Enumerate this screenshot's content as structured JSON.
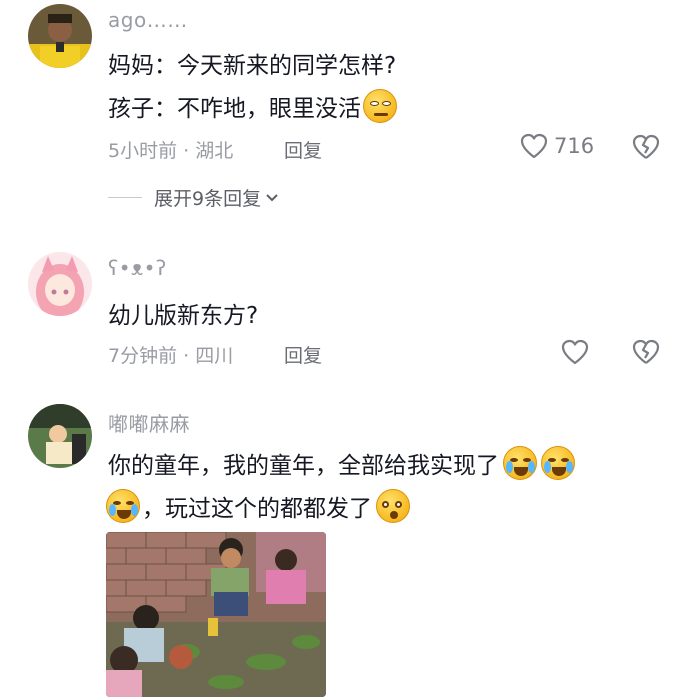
{
  "comments": [
    {
      "username": "ago……",
      "lines": [
        "妈妈：今天新来的同学怎样?",
        "孩子：不咋地，眼里没活"
      ],
      "time_location": "5小时前 · 湖北",
      "reply_label": "回复",
      "like_count": "716",
      "expand_label": "展开9条回复"
    },
    {
      "username": "ʕ•ᴥ•ʔ",
      "lines": [
        "幼儿版新东方?"
      ],
      "time_location": "7分钟前 · 四川",
      "reply_label": "回复"
    },
    {
      "username": "嘟嘟麻麻",
      "lines": [
        "你的童年，我的童年，全部给我实现了",
        "，玩过这个的都都发了"
      ],
      "time_location": "",
      "reply_label": ""
    }
  ],
  "icons": {
    "like": "heart-outline-icon",
    "dislike": "broken-heart-icon",
    "expand": "chevron-down-icon"
  },
  "colors": {
    "text_primary": "#161823",
    "text_secondary": "#9a9ca3"
  }
}
